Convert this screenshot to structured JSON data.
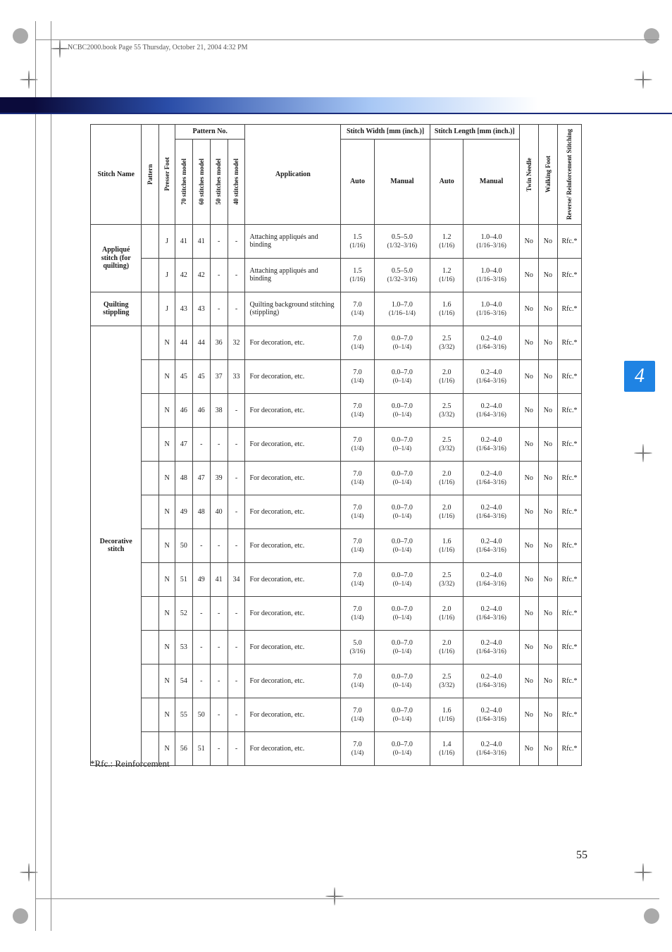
{
  "meta": {
    "headerline": "NCBC2000.book  Page 55  Thursday, October 21, 2004  4:32 PM",
    "tab": "4",
    "pagenum": "55",
    "footnote": "*Rfc.: Reinforcement"
  },
  "headers": {
    "stitch_name": "Stitch Name",
    "pattern": "Pattern",
    "presser": "Presser Foot",
    "pattern_no": "Pattern No.",
    "pn70": "70 stitches model",
    "pn60": "60 stitches model",
    "pn50": "50 stitches model",
    "pn40": "40 stitches model",
    "app": "Application",
    "sw": "Stitch Width [mm (inch.)]",
    "sl": "Stitch Length [mm (inch.)]",
    "auto": "Auto",
    "manual": "Manual",
    "twin": "Twin Needle",
    "walking": "Walking Foot",
    "rfc": "Reverse/ Reinforcement Stitching"
  },
  "groups": {
    "applique": "Appliqué stitch (for quilting)",
    "stippling": "Quilting stippling",
    "decorative": "Decorative stitch"
  },
  "rows": [
    {
      "foot": "J",
      "p70": "41",
      "p60": "41",
      "p50": "-",
      "p40": "-",
      "app": "Attaching appliqués and binding",
      "swa": "1.5",
      "swa2": "(1/16)",
      "swm": "0.5–5.0",
      "swm2": "(1/32–3/16)",
      "sla": "1.2",
      "sla2": "(1/16)",
      "slm": "1.0–4.0",
      "slm2": "(1/16–3/16)",
      "tw": "No",
      "wf": "No",
      "rfc": "Rfc.*",
      "grp": "applique"
    },
    {
      "foot": "J",
      "p70": "42",
      "p60": "42",
      "p50": "-",
      "p40": "-",
      "app": "Attaching appliqués and binding",
      "swa": "1.5",
      "swa2": "(1/16)",
      "swm": "0.5–5.0",
      "swm2": "(1/32–3/16)",
      "sla": "1.2",
      "sla2": "(1/16)",
      "slm": "1.0–4.0",
      "slm2": "(1/16–3/16)",
      "tw": "No",
      "wf": "No",
      "rfc": "Rfc.*",
      "grp": "applique"
    },
    {
      "foot": "J",
      "p70": "43",
      "p60": "43",
      "p50": "-",
      "p40": "-",
      "app": "Quilting background stitching (stippling)",
      "swa": "7.0",
      "swa2": "(1/4)",
      "swm": "1.0–7.0",
      "swm2": "(1/16–1/4)",
      "sla": "1.6",
      "sla2": "(1/16)",
      "slm": "1.0–4.0",
      "slm2": "(1/16–3/16)",
      "tw": "No",
      "wf": "No",
      "rfc": "Rfc.*",
      "grp": "stippling"
    },
    {
      "foot": "N",
      "p70": "44",
      "p60": "44",
      "p50": "36",
      "p40": "32",
      "app": "For decoration, etc.",
      "swa": "7.0",
      "swa2": "(1/4)",
      "swm": "0.0–7.0",
      "swm2": "(0–1/4)",
      "sla": "2.5",
      "sla2": "(3/32)",
      "slm": "0.2–4.0",
      "slm2": "(1/64–3/16)",
      "tw": "No",
      "wf": "No",
      "rfc": "Rfc.*",
      "grp": "decorative"
    },
    {
      "foot": "N",
      "p70": "45",
      "p60": "45",
      "p50": "37",
      "p40": "33",
      "app": "For decoration, etc.",
      "swa": "7.0",
      "swa2": "(1/4)",
      "swm": "0.0–7.0",
      "swm2": "(0–1/4)",
      "sla": "2.0",
      "sla2": "(1/16)",
      "slm": "0.2–4.0",
      "slm2": "(1/64–3/16)",
      "tw": "No",
      "wf": "No",
      "rfc": "Rfc.*",
      "grp": "decorative"
    },
    {
      "foot": "N",
      "p70": "46",
      "p60": "46",
      "p50": "38",
      "p40": "-",
      "app": "For decoration, etc.",
      "swa": "7.0",
      "swa2": "(1/4)",
      "swm": "0.0–7.0",
      "swm2": "(0–1/4)",
      "sla": "2.5",
      "sla2": "(3/32)",
      "slm": "0.2–4.0",
      "slm2": "(1/64–3/16)",
      "tw": "No",
      "wf": "No",
      "rfc": "Rfc.*",
      "grp": "decorative"
    },
    {
      "foot": "N",
      "p70": "47",
      "p60": "-",
      "p50": "-",
      "p40": "-",
      "app": "For decoration, etc.",
      "swa": "7.0",
      "swa2": "(1/4)",
      "swm": "0.0–7.0",
      "swm2": "(0–1/4)",
      "sla": "2.5",
      "sla2": "(3/32)",
      "slm": "0.2–4.0",
      "slm2": "(1/64–3/16)",
      "tw": "No",
      "wf": "No",
      "rfc": "Rfc.*",
      "grp": "decorative"
    },
    {
      "foot": "N",
      "p70": "48",
      "p60": "47",
      "p50": "39",
      "p40": "-",
      "app": "For decoration, etc.",
      "swa": "7.0",
      "swa2": "(1/4)",
      "swm": "0.0–7.0",
      "swm2": "(0–1/4)",
      "sla": "2.0",
      "sla2": "(1/16)",
      "slm": "0.2–4.0",
      "slm2": "(1/64–3/16)",
      "tw": "No",
      "wf": "No",
      "rfc": "Rfc.*",
      "grp": "decorative"
    },
    {
      "foot": "N",
      "p70": "49",
      "p60": "48",
      "p50": "40",
      "p40": "-",
      "app": "For decoration, etc.",
      "swa": "7.0",
      "swa2": "(1/4)",
      "swm": "0.0–7.0",
      "swm2": "(0–1/4)",
      "sla": "2.0",
      "sla2": "(1/16)",
      "slm": "0.2–4.0",
      "slm2": "(1/64–3/16)",
      "tw": "No",
      "wf": "No",
      "rfc": "Rfc.*",
      "grp": "decorative"
    },
    {
      "foot": "N",
      "p70": "50",
      "p60": "-",
      "p50": "-",
      "p40": "-",
      "app": "For decoration, etc.",
      "swa": "7.0",
      "swa2": "(1/4)",
      "swm": "0.0–7.0",
      "swm2": "(0–1/4)",
      "sla": "1.6",
      "sla2": "(1/16)",
      "slm": "0.2–4.0",
      "slm2": "(1/64–3/16)",
      "tw": "No",
      "wf": "No",
      "rfc": "Rfc.*",
      "grp": "decorative"
    },
    {
      "foot": "N",
      "p70": "51",
      "p60": "49",
      "p50": "41",
      "p40": "34",
      "app": "For decoration, etc.",
      "swa": "7.0",
      "swa2": "(1/4)",
      "swm": "0.0–7.0",
      "swm2": "(0–1/4)",
      "sla": "2.5",
      "sla2": "(3/32)",
      "slm": "0.2–4.0",
      "slm2": "(1/64–3/16)",
      "tw": "No",
      "wf": "No",
      "rfc": "Rfc.*",
      "grp": "decorative"
    },
    {
      "foot": "N",
      "p70": "52",
      "p60": "-",
      "p50": "-",
      "p40": "-",
      "app": "For decoration, etc.",
      "swa": "7.0",
      "swa2": "(1/4)",
      "swm": "0.0–7.0",
      "swm2": "(0–1/4)",
      "sla": "2.0",
      "sla2": "(1/16)",
      "slm": "0.2–4.0",
      "slm2": "(1/64–3/16)",
      "tw": "No",
      "wf": "No",
      "rfc": "Rfc.*",
      "grp": "decorative"
    },
    {
      "foot": "N",
      "p70": "53",
      "p60": "-",
      "p50": "-",
      "p40": "-",
      "app": "For decoration, etc.",
      "swa": "5.0",
      "swa2": "(3/16)",
      "swm": "0.0–7.0",
      "swm2": "(0–1/4)",
      "sla": "2.0",
      "sla2": "(1/16)",
      "slm": "0.2–4.0",
      "slm2": "(1/64–3/16)",
      "tw": "No",
      "wf": "No",
      "rfc": "Rfc.*",
      "grp": "decorative"
    },
    {
      "foot": "N",
      "p70": "54",
      "p60": "-",
      "p50": "-",
      "p40": "-",
      "app": "For decoration, etc.",
      "swa": "7.0",
      "swa2": "(1/4)",
      "swm": "0.0–7.0",
      "swm2": "(0–1/4)",
      "sla": "2.5",
      "sla2": "(3/32)",
      "slm": "0.2–4.0",
      "slm2": "(1/64–3/16)",
      "tw": "No",
      "wf": "No",
      "rfc": "Rfc.*",
      "grp": "decorative"
    },
    {
      "foot": "N",
      "p70": "55",
      "p60": "50",
      "p50": "-",
      "p40": "-",
      "app": "For decoration, etc.",
      "swa": "7.0",
      "swa2": "(1/4)",
      "swm": "0.0–7.0",
      "swm2": "(0–1/4)",
      "sla": "1.6",
      "sla2": "(1/16)",
      "slm": "0.2–4.0",
      "slm2": "(1/64–3/16)",
      "tw": "No",
      "wf": "No",
      "rfc": "Rfc.*",
      "grp": "decorative"
    },
    {
      "foot": "N",
      "p70": "56",
      "p60": "51",
      "p50": "-",
      "p40": "-",
      "app": "For decoration, etc.",
      "swa": "7.0",
      "swa2": "(1/4)",
      "swm": "0.0–7.0",
      "swm2": "(0–1/4)",
      "sla": "1.4",
      "sla2": "(1/16)",
      "slm": "0.2–4.0",
      "slm2": "(1/64–3/16)",
      "tw": "No",
      "wf": "No",
      "rfc": "Rfc.*",
      "grp": "decorative"
    }
  ]
}
